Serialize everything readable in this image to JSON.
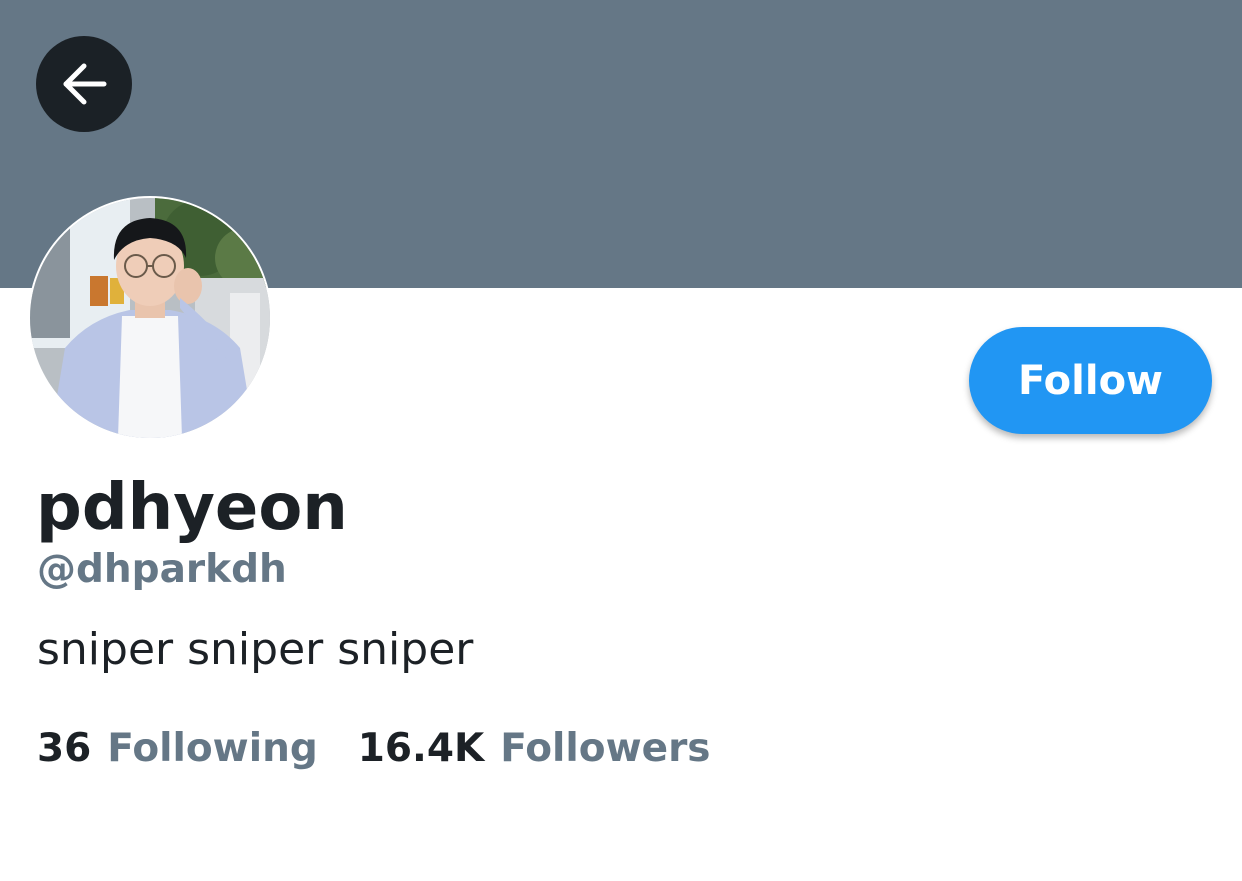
{
  "banner": {
    "color": "#657786"
  },
  "back_button": {
    "icon": "arrow-left-icon"
  },
  "profile": {
    "display_name": "pdhyeon",
    "handle": "@dhparkdh",
    "bio": "sniper sniper sniper",
    "avatar": "profile-photo"
  },
  "follow_button": {
    "label": "Follow",
    "color": "#2196f3"
  },
  "stats": {
    "following_count": "36",
    "following_label": "Following",
    "followers_count": "16.4K",
    "followers_label": "Followers"
  }
}
